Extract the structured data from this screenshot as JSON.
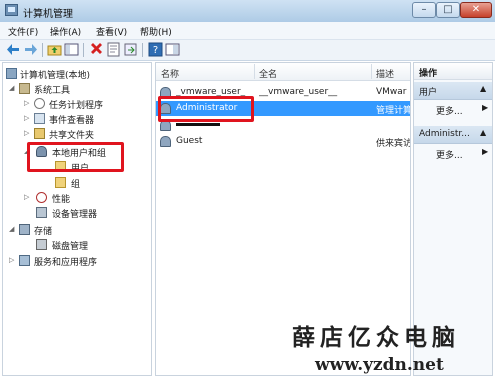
{
  "window": {
    "title": "计算机管理",
    "min_label": "–",
    "max_label": "□",
    "close_label": "✕"
  },
  "menu": [
    "文件(F)",
    "操作(A)",
    "查看(V)",
    "帮助(H)"
  ],
  "toolbar": {
    "icons": [
      "back-arrow-icon",
      "forward-arrow-icon",
      "up-folder-icon",
      "show-tree-icon",
      "delete-icon",
      "properties-icon",
      "export-icon",
      "help-icon",
      "console-icon"
    ]
  },
  "tree": {
    "items": [
      {
        "label": "计算机管理(本地)",
        "expander": ""
      },
      {
        "label": "系统工具",
        "expander": "◢"
      },
      {
        "label": "任务计划程序",
        "expander": "▷"
      },
      {
        "label": "事件查看器",
        "expander": "▷"
      },
      {
        "label": "共享文件夹",
        "expander": "▷"
      },
      {
        "label": "本地用户和组",
        "expander": "◢"
      },
      {
        "label": "用户",
        "expander": ""
      },
      {
        "label": "组",
        "expander": ""
      },
      {
        "label": "性能",
        "expander": "▷"
      },
      {
        "label": "设备管理器",
        "expander": ""
      },
      {
        "label": "存储",
        "expander": "◢"
      },
      {
        "label": "磁盘管理",
        "expander": ""
      },
      {
        "label": "服务和应用程序",
        "expander": "▷"
      }
    ]
  },
  "list": {
    "headers": [
      "名称",
      "全名",
      "描述"
    ],
    "rows": [
      {
        "name": "_vmware_user_",
        "fullname": "__vmware_user__",
        "desc": "VMwar",
        "selected": false
      },
      {
        "name": "Administrator",
        "fullname": "",
        "desc": "管理计算",
        "selected": true
      },
      {
        "name": "",
        "fullname": "",
        "desc": "",
        "selected": false
      },
      {
        "name": "Guest",
        "fullname": "",
        "desc": "供来宾访",
        "selected": false
      }
    ]
  },
  "actions": {
    "title": "操作",
    "sections": [
      {
        "label": "用户",
        "more": "更多..."
      },
      {
        "label": "Administr...",
        "more": "更多..."
      }
    ]
  },
  "watermark": {
    "brand": "薛店亿众电脑",
    "url": "www.yzdn.net"
  },
  "colors": {
    "selection": "#3399ff",
    "highlight_box": "#e0141e"
  }
}
